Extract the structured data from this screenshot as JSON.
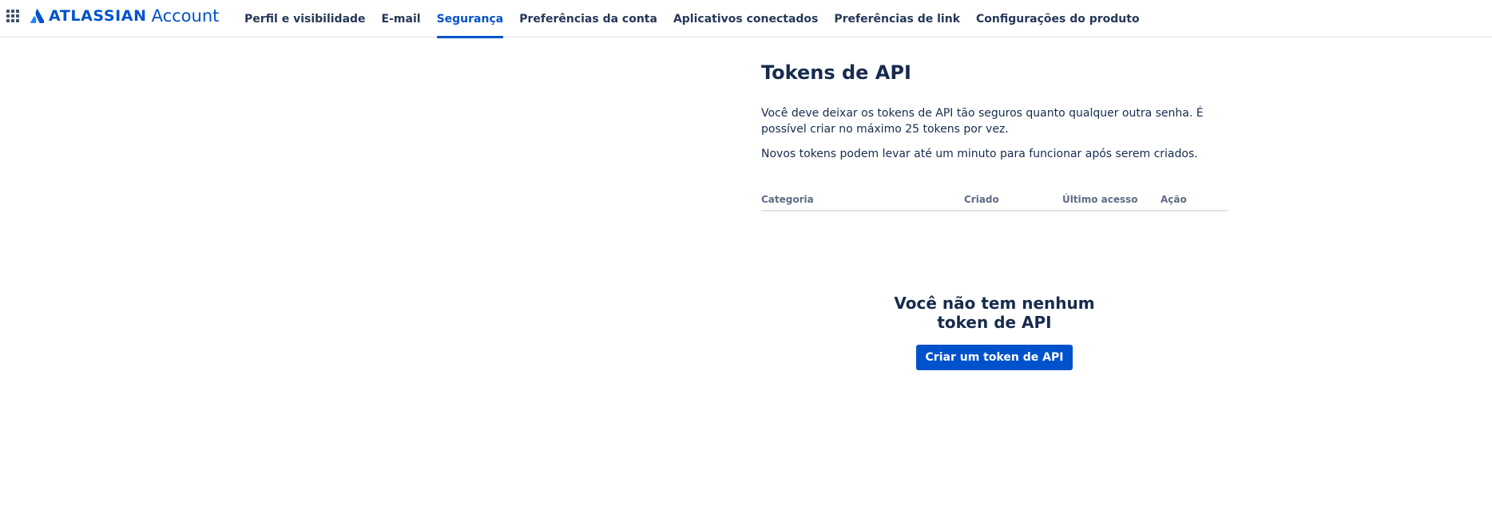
{
  "header": {
    "brand": "ATLASSIAN",
    "product": "Account",
    "brand_color": "#0052cc",
    "apps_icon": "app-switcher-grid-icon",
    "logo_icon": "atlassian-logo-icon"
  },
  "nav": {
    "items": [
      {
        "label": "Perfil e visibilidade",
        "active": false
      },
      {
        "label": "E-mail",
        "active": false
      },
      {
        "label": "Segurança",
        "active": true
      },
      {
        "label": "Preferências da conta",
        "active": false
      },
      {
        "label": "Aplicativos conectados",
        "active": false
      },
      {
        "label": "Preferências de link",
        "active": false
      },
      {
        "label": "Configurações do produto",
        "active": false
      }
    ]
  },
  "main": {
    "title": "Tokens de API",
    "description_1": "Você deve deixar os tokens de API tão seguros quanto qualquer outra senha. É possível criar no máximo 25 tokens por vez.",
    "description_2": "Novos tokens podem levar até um minuto para funcionar após serem criados.",
    "table": {
      "columns": [
        "Categoria",
        "Criado",
        "Último acesso",
        "Ação"
      ],
      "rows": []
    },
    "empty_state": {
      "title": "Você não tem nenhum token de API",
      "button_label": "Criar um token de API"
    }
  }
}
